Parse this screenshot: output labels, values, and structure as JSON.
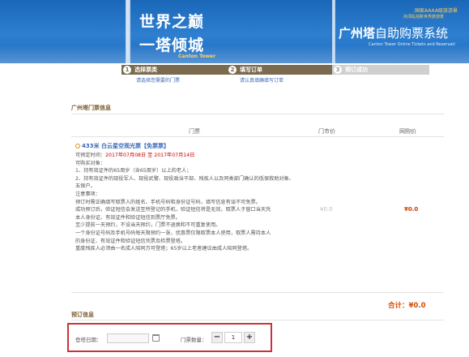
{
  "header": {
    "slogan_line1": "世界之巅",
    "slogan_line2": "一塔倾城",
    "slogan_sub": "Canton Tower",
    "badge_line1": "国家AAAA级旅游景",
    "badge_line2": "尚须乱拍新世界旅游景",
    "brand_bold": "广州塔",
    "brand_light": "自助购票系统",
    "brand_en": "Canton Tower Online Tickets and Reservati"
  },
  "steps": [
    {
      "num": "1",
      "label": "选择票类",
      "sub": "请选择您需要的门票"
    },
    {
      "num": "2",
      "label": "填写订单",
      "sub": "请认真填确填写订单"
    },
    {
      "num": "3",
      "label": "预订成功",
      "sub": ""
    }
  ],
  "ticket_section": {
    "title": "广州塔门票信息",
    "columns": [
      "门票",
      "门市价",
      "网购价"
    ]
  },
  "ticket": {
    "name": "433米 白云星空观光票【免票票】",
    "desc_lines": [
      {
        "prefix": "可预定时间：",
        "red": "2017年07月08日 至 2017年07月14日"
      },
      {
        "text": "可购买对象："
      },
      {
        "text": "1、持有效证件的65周岁（含65周岁）以上的老人；"
      },
      {
        "text": "2、持有效证件的现役军人、现役武警、现役政治干部、残疾人以及同类部门确认的低保救助对象、"
      },
      {
        "text": "五保户。"
      },
      {
        "text": "注意事项："
      },
      {
        "text": "预订时需正确填写取票人的姓名、手机号码和身份证号码，填写信息有误不可免票。"
      },
      {
        "text": "成功预订后，验证短信会发送至所登记的手机，验证短信将是无效，取票人于窗口当天凭"
      },
      {
        "text": "本人身份证、有效证件和验证短信到票厅免票。"
      },
      {
        "text": "至少提前一天预约，不设当天预约，门票不退换和不可重复使用。"
      },
      {
        "text": "一个身份证号码及手机号码每天限预约一张，优惠票仅限取票本人使用，取票人需持本人"
      },
      {
        "text": "的身份证、有效证件和验证短信凭票及检票登塔。"
      },
      {
        "text": "重度残疾人必须由一名成人陪同方可登塔；65岁以上老者建议由成人陪同登塔。"
      }
    ],
    "door_price": "¥0.0",
    "online_price": "¥0.0"
  },
  "total": {
    "label": "合计：",
    "value": "¥0.0"
  },
  "booking": {
    "title": "预订信息",
    "date_label": "登塔日期：",
    "date_value": "",
    "qty_label": "门票数量：",
    "minus": "−",
    "qty": "1",
    "plus": "+"
  }
}
